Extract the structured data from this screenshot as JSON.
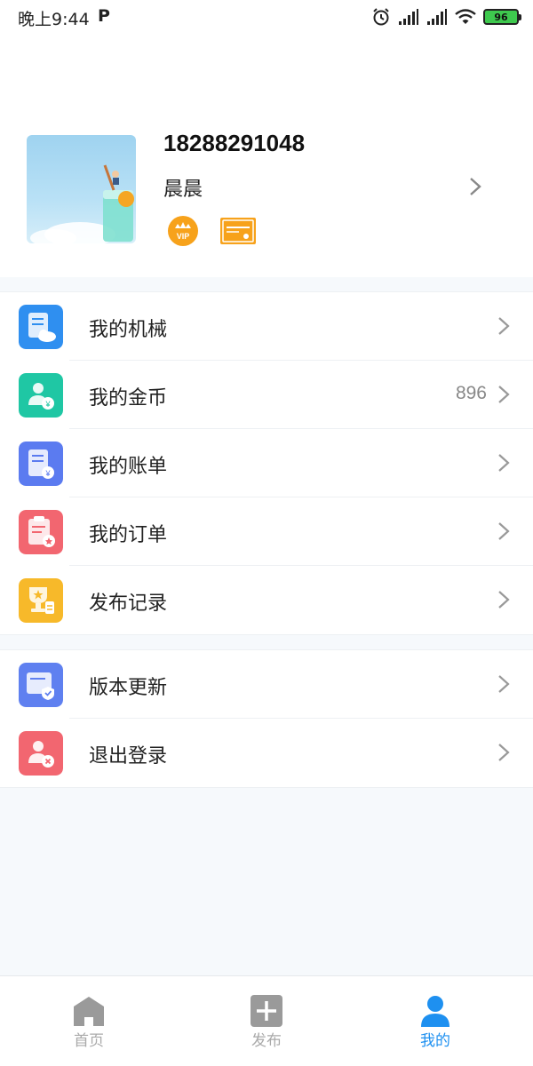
{
  "status_bar": {
    "time": "晚上9:44",
    "p_indicator": "P",
    "battery": "96",
    "icons": [
      "alarm-icon",
      "signal-icon",
      "signal-icon",
      "wifi-icon",
      "battery-icon"
    ]
  },
  "profile": {
    "phone": "18288291048",
    "nickname": "晨晨",
    "badges": [
      "vip-badge-icon",
      "card-badge-icon"
    ]
  },
  "menu_group_1": [
    {
      "label": "我的机械",
      "value": "",
      "icon": "machinery-icon",
      "color": "#2f8ff0"
    },
    {
      "label": "我的金币",
      "value": "896",
      "icon": "coins-icon",
      "color": "#1fc7a4"
    },
    {
      "label": "我的账单",
      "value": "",
      "icon": "bill-icon",
      "color": "#5b7bf0"
    },
    {
      "label": "我的订单",
      "value": "",
      "icon": "order-icon",
      "color": "#f26670"
    },
    {
      "label": "发布记录",
      "value": "",
      "icon": "publish-record-icon",
      "color": "#f7b92a"
    }
  ],
  "menu_group_2": [
    {
      "label": "版本更新",
      "value": "",
      "icon": "version-update-icon",
      "color": "#5f80f0"
    },
    {
      "label": "退出登录",
      "value": "",
      "icon": "logout-icon",
      "color": "#f26670"
    }
  ],
  "bottom_nav": [
    {
      "label": "首页",
      "icon": "home-icon",
      "active": false
    },
    {
      "label": "发布",
      "icon": "plus-icon",
      "active": false
    },
    {
      "label": "我的",
      "icon": "user-icon",
      "active": true
    }
  ],
  "colors": {
    "accent": "#1e90f0",
    "badge_orange": "#f7a21b"
  }
}
